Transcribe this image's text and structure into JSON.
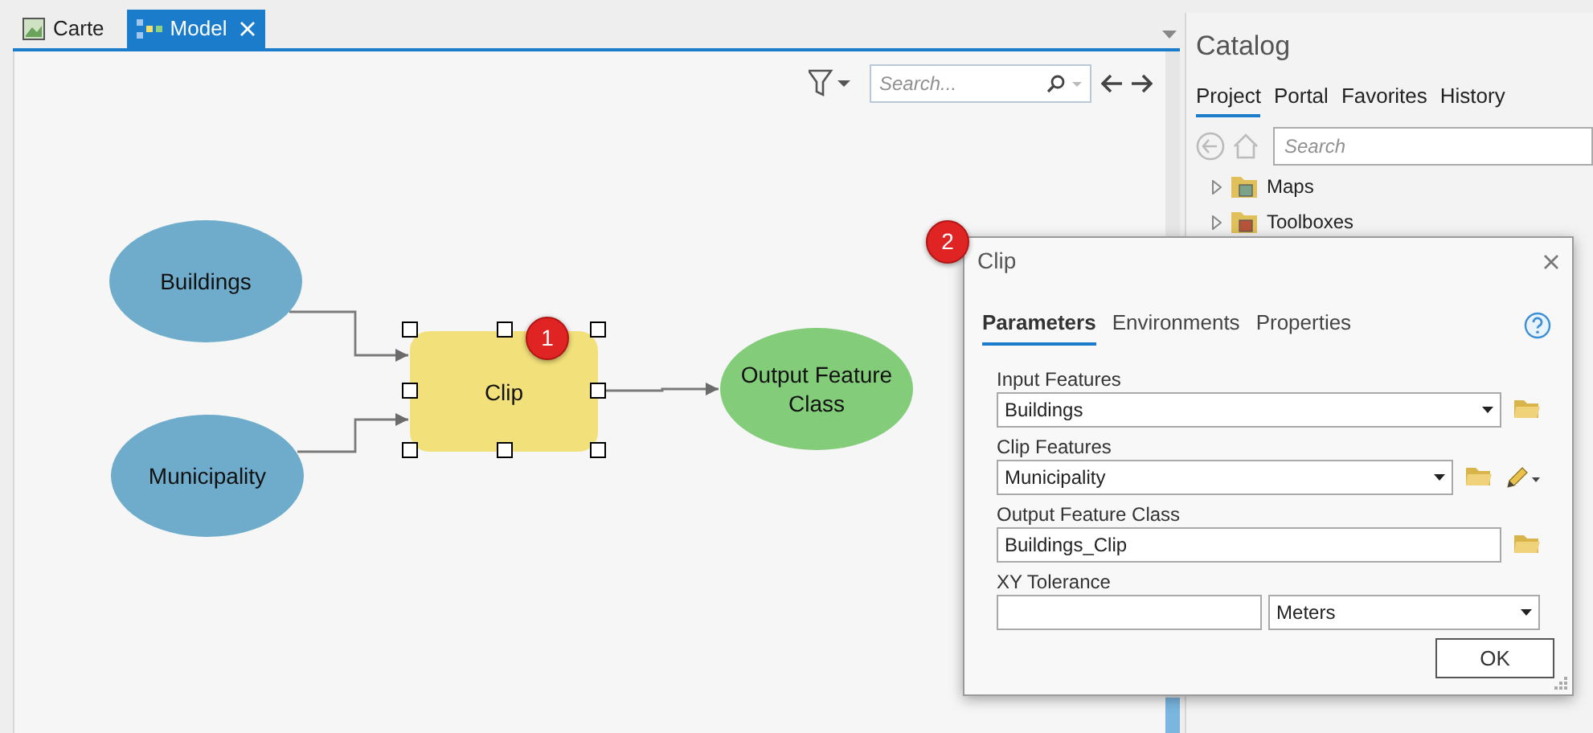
{
  "document_tabs": [
    {
      "label": "Carte",
      "selected": false,
      "closable": false
    },
    {
      "label": "Model",
      "selected": true,
      "closable": true
    }
  ],
  "model_toolbar": {
    "search": {
      "placeholder": "Search..."
    }
  },
  "model": {
    "nodes": [
      {
        "kind": "data",
        "label": "Buildings",
        "selected": false
      },
      {
        "kind": "data",
        "label": "Municipality",
        "selected": false
      },
      {
        "kind": "tool",
        "label": "Clip",
        "selected": true
      },
      {
        "kind": "output",
        "label": "Output Feature Class",
        "selected": false
      }
    ],
    "callouts": [
      "1",
      "2"
    ]
  },
  "catalog": {
    "title": "Catalog",
    "tabs": [
      {
        "label": "Project",
        "selected": true
      },
      {
        "label": "Portal",
        "selected": false
      },
      {
        "label": "Favorites",
        "selected": false
      },
      {
        "label": "History",
        "selected": false
      }
    ],
    "search": {
      "placeholder": "Search"
    },
    "items": [
      {
        "label": "Maps",
        "kind": "maps",
        "expanded": false
      },
      {
        "label": "Toolboxes",
        "kind": "toolboxes",
        "expanded": false
      }
    ]
  },
  "dialog": {
    "title": "Clip",
    "tabs": [
      {
        "label": "Parameters",
        "selected": true
      },
      {
        "label": "Environments",
        "selected": false
      },
      {
        "label": "Properties",
        "selected": false
      }
    ],
    "parameters": [
      {
        "kind": "layer_input",
        "label": "Input Features",
        "value": "Buildings"
      },
      {
        "kind": "feature_input",
        "label": "Clip Features",
        "value": "Municipality"
      },
      {
        "kind": "output",
        "label": "Output Feature Class",
        "value": "Buildings_Clip"
      },
      {
        "kind": "linear_unit",
        "label": "XY Tolerance",
        "unit": "Meters"
      }
    ],
    "ok_button": "OK"
  }
}
